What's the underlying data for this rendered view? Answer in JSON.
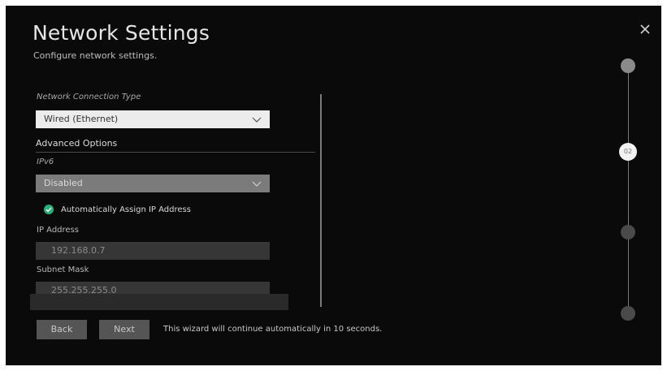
{
  "header": {
    "title": "Network Settings",
    "subtitle": "Configure network settings.",
    "close_icon": "close-icon"
  },
  "form": {
    "connection_type": {
      "label": "Network Connection Type",
      "value": "Wired (Ethernet)"
    },
    "advanced_options": {
      "header": "Advanced Options",
      "ipv6": {
        "label": "IPv6",
        "value": "Disabled"
      },
      "auto_assign": {
        "label": "Automatically Assign IP Address",
        "checked": true,
        "color": "#29b07a"
      },
      "ip_address": {
        "label": "IP Address",
        "value": "192.168.0.7"
      },
      "subnet_mask": {
        "label": "Subnet Mask",
        "value": "255.255.255.0"
      }
    }
  },
  "footer": {
    "back_label": "Back",
    "next_label": "Next",
    "message": "This wizard will continue automatically in 10 seconds."
  },
  "stepper": {
    "current_step": "02",
    "current_index": 1,
    "total_steps": 4
  }
}
